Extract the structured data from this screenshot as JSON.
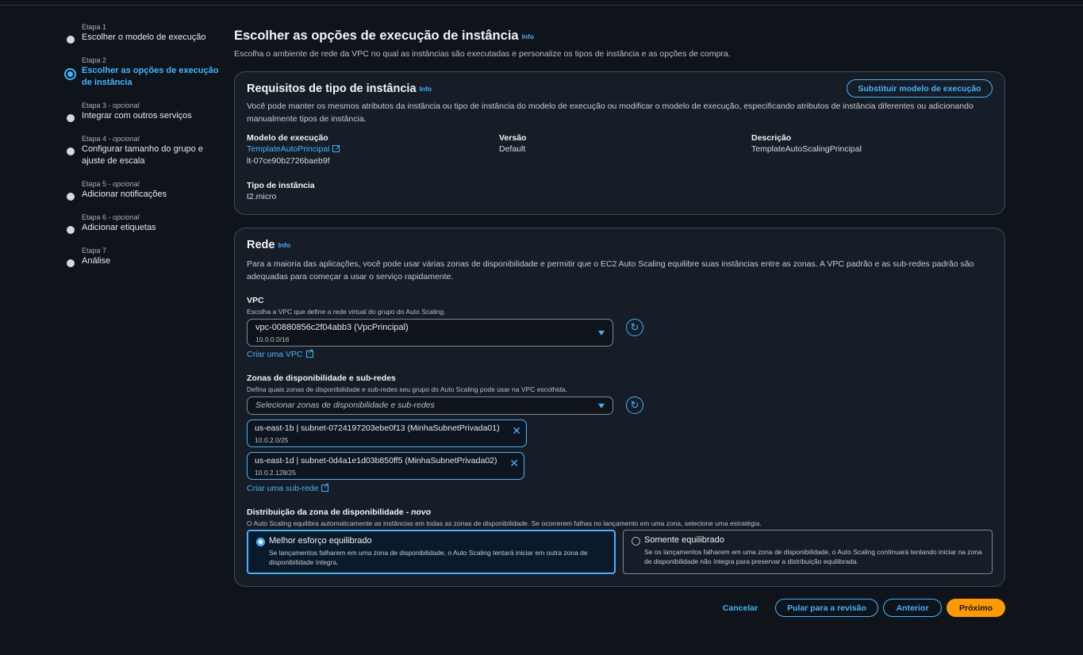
{
  "steps": [
    {
      "label": "Etapa 1",
      "optional": "",
      "name": "Escolher o modelo de execução"
    },
    {
      "label": "Etapa 2",
      "optional": "",
      "name": "Escolher as opções de execução de instância"
    },
    {
      "label": "Etapa 3 - ",
      "optional": "opcional",
      "name": "Integrar com outros serviços"
    },
    {
      "label": "Etapa 4 - ",
      "optional": "opcional",
      "name": "Configurar tamanho do grupo e ajuste de escala"
    },
    {
      "label": "Etapa 5 - ",
      "optional": "opcional",
      "name": "Adicionar notificações"
    },
    {
      "label": "Etapa 6 - ",
      "optional": "opcional",
      "name": "Adicionar etiquetas"
    },
    {
      "label": "Etapa 7",
      "optional": "",
      "name": "Análise"
    }
  ],
  "page": {
    "title": "Escolher as opções de execução de instância",
    "info": "Info",
    "subtitle": "Escolha o ambiente de rede da VPC no qual as instâncias são executadas e personalize os tipos de instância e as opções de compra."
  },
  "requirements": {
    "title": "Requisitos de tipo de instância",
    "info": "Info",
    "replace_button": "Substituir modelo de execução",
    "description": "Você pode manter os mesmos atributos da instância ou tipo de instância do modelo de execução ou modificar o modelo de execução, especificando atributos de instância diferentes ou adicionando manualmente tipos de instância.",
    "template_label": "Modelo de execução",
    "template_link": "TemplateAutoPrincipal",
    "template_id": "lt-07ce90b2726baeb9f",
    "version_label": "Versão",
    "version_value": "Default",
    "description_label": "Descrição",
    "description_value": "TemplateAutoScalingPrincipal",
    "instance_type_label": "Tipo de instância",
    "instance_type_value": "t2.micro"
  },
  "network": {
    "title": "Rede",
    "info": "Info",
    "description": "Para a maioria das aplicações, você pode usar várias zonas de disponibilidade e permitir que o EC2 Auto Scaling equilibre suas instâncias entre as zonas. A VPC padrão e as sub-redes padrão são adequadas para começar a usar o serviço rapidamente.",
    "vpc_label": "VPC",
    "vpc_desc": "Escolha a VPC que define a rede virtual do grupo do Auto Scaling.",
    "vpc_value": "vpc-00880856c2f04abb3 (VpcPrincipal)",
    "vpc_cidr": "10.0.0.0/16",
    "create_vpc": "Criar uma VPC",
    "az_label": "Zonas de disponibilidade e sub-redes",
    "az_desc": "Defina quais zonas de disponibilidade e sub-redes seu grupo do Auto Scaling pode usar na VPC escolhida.",
    "az_placeholder": "Selecionar zonas de disponibilidade e sub-redes",
    "subnets": [
      {
        "name": "us-east-1b | subnet-0724197203ebe0f13 (MinhaSubnetPrivada01)",
        "cidr": "10.0.2.0/25"
      },
      {
        "name": "us-east-1d | subnet-0d4a1e1d03b850ff5 (MinhaSubnetPrivada02)",
        "cidr": "10.0.2.128/25"
      }
    ],
    "create_subnet": "Criar uma sub-rede",
    "dist_label": "Distribuição da zona de disponibilidade - ",
    "dist_label_new": "novo",
    "dist_desc": "O Auto Scaling equilibra automaticamente as instâncias em todas as zonas de disponibilidade. Se ocorrerem falhas no lançamento em uma zona, selecione uma estratégia.",
    "options": [
      {
        "title": "Melhor esforço equilibrado",
        "desc": "Se lançamentos falharem em uma zona de disponibilidade, o Auto Scaling tentará iniciar em outra zona de disponibilidade íntegra.",
        "selected": true
      },
      {
        "title": "Somente equilibrado",
        "desc": "Se os lançamentos falharem em uma zona de disponibilidade, o Auto Scaling continuará tentando iniciar na zona de disponibilidade não íntegra para preservar a distribuição equilibrada.",
        "selected": false
      }
    ]
  },
  "footer": {
    "cancel": "Cancelar",
    "skip": "Pular para a revisão",
    "previous": "Anterior",
    "next": "Próximo"
  },
  "colors": {
    "accent": "#42b4ff",
    "primary": "#ff9900",
    "background": "#0f141a",
    "card": "#161d26"
  }
}
